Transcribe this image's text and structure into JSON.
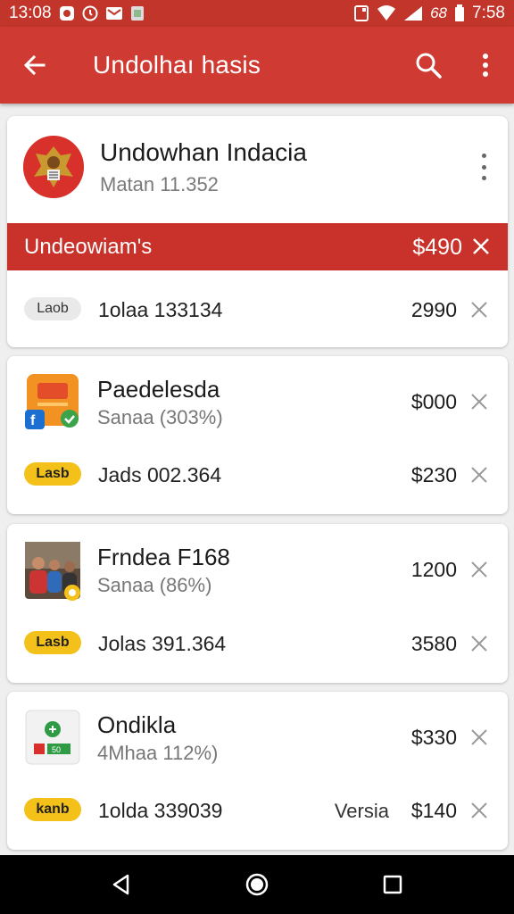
{
  "statusbar": {
    "left_text": "13:08",
    "time": "7:58",
    "battery_text": "68"
  },
  "appbar": {
    "title": "Undolhaı hasis"
  },
  "card1": {
    "title": "Undowhan Indacia",
    "subtitle": "Matan 11.352",
    "banner": {
      "label": "Undeowiam's",
      "amount": "$490"
    },
    "row": {
      "tag": "Laob",
      "text": "1olaa 133134",
      "amount": "2990"
    }
  },
  "card2": {
    "title": "Paedelesda",
    "subtitle": "Sanaa (303%)",
    "amount": "$000",
    "row": {
      "tag": "Lasb",
      "text": "Jads 002.364",
      "amount": "$230"
    }
  },
  "card3": {
    "title": "Frndea F168",
    "subtitle": "Sanaa (86%)",
    "amount": "1200",
    "row": {
      "tag": "Lasb",
      "text": "Jolas 391.364",
      "amount": "3580"
    }
  },
  "card4": {
    "title": "Ondikla",
    "subtitle": "4Mhaa 112%)",
    "amount": "$330",
    "row": {
      "tag": "kanb",
      "text": "1olda 339039",
      "extra": "Versia",
      "amount": "$140"
    }
  },
  "colors": {
    "primary": "#cf3a32",
    "status": "#c1352b",
    "accent_yellow": "#f3c119"
  },
  "icons": [
    "back-arrow-icon",
    "search-icon",
    "more-vert-icon",
    "close-icon",
    "nav-back-icon",
    "nav-home-icon",
    "nav-recents-icon"
  ]
}
